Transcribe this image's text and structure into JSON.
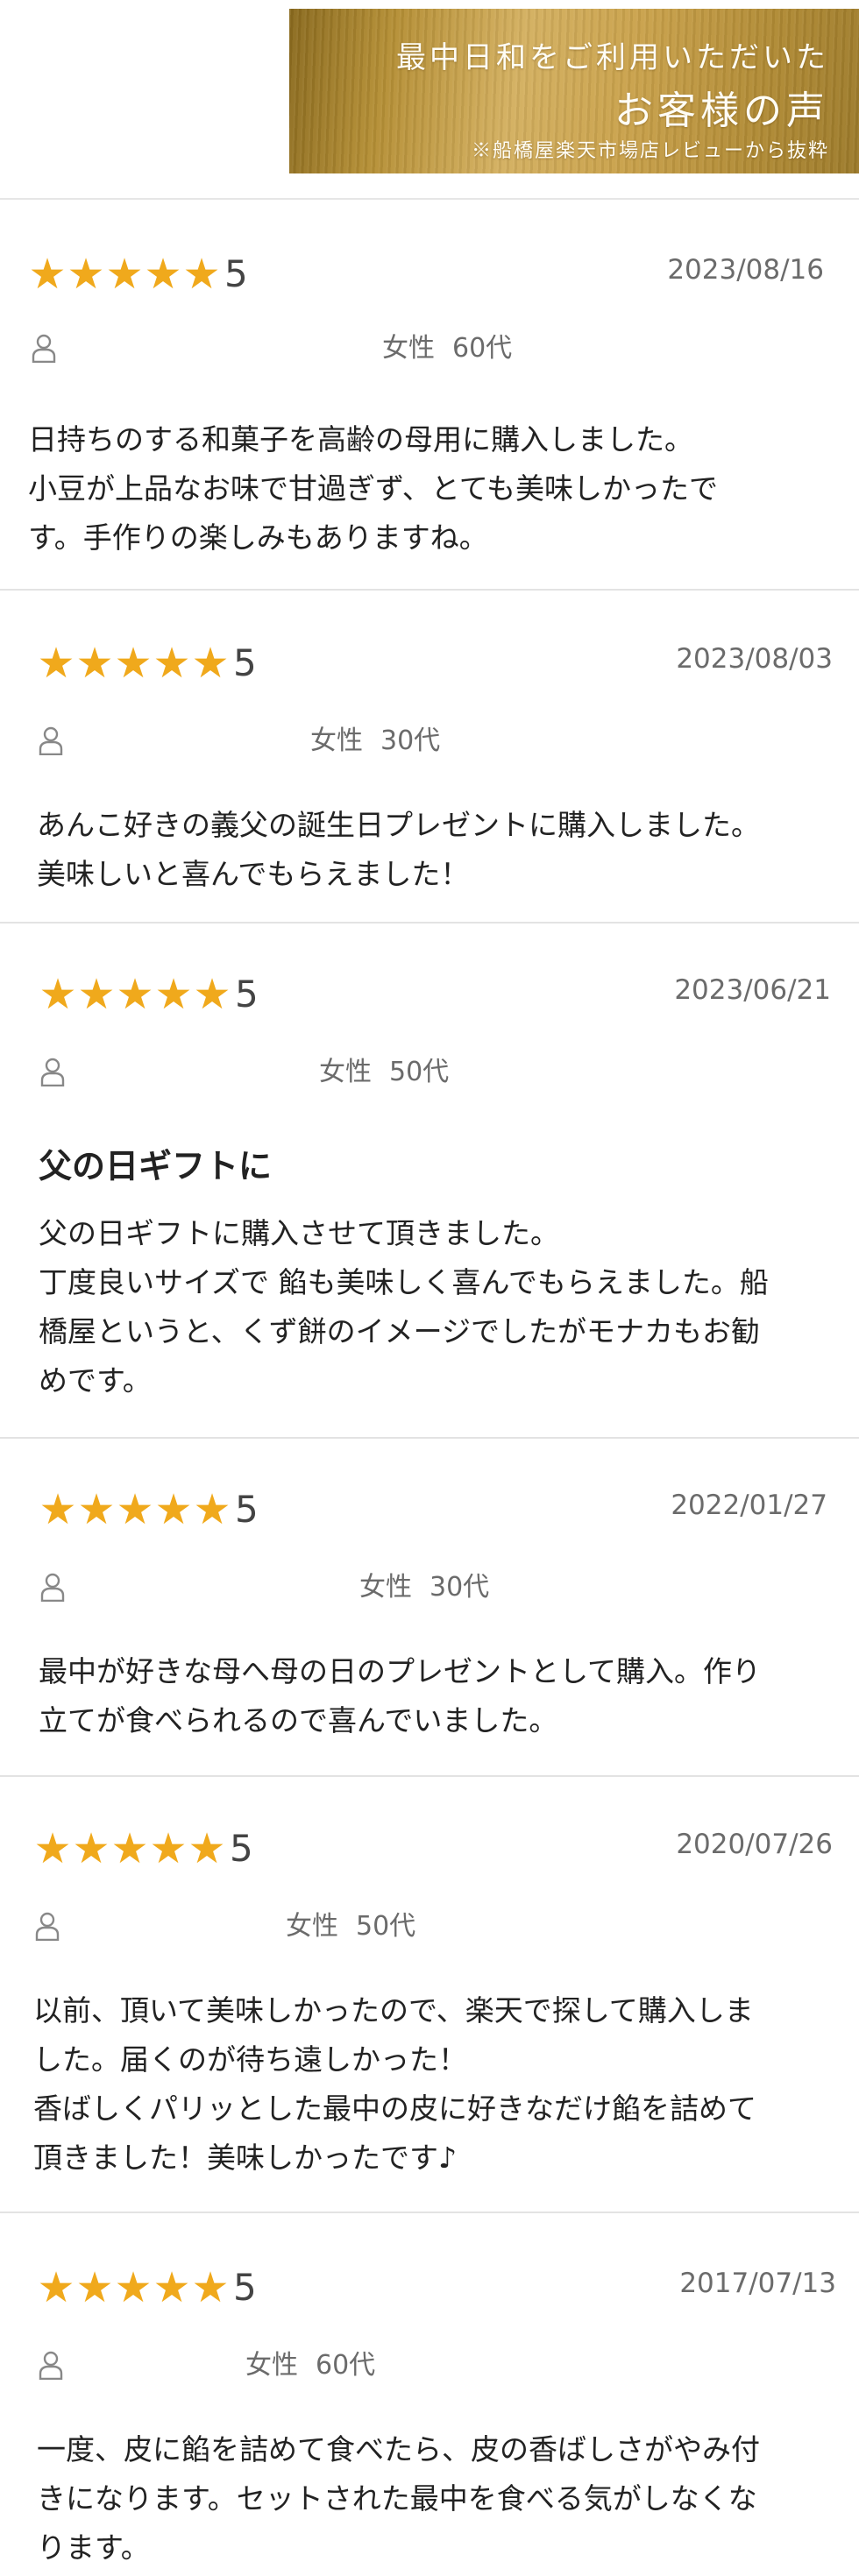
{
  "header": {
    "line1": "最中日和をご利用いただいた",
    "line2": "お客様の声",
    "line3": "※船橋屋楽天市場店レビューから抜粋"
  },
  "colors": {
    "star": "#f0a91c",
    "banner_gold": "#c9a14a"
  },
  "icons": {
    "star": "star-icon",
    "user": "user-icon"
  },
  "reviews": [
    {
      "rating": 5,
      "score": "5",
      "date": "2023/08/16",
      "gender": "女性",
      "age": "60代",
      "title": "",
      "lines": [
        "日持ちのする和菓子を高齢の母用に購入しました。",
        "小豆が上品なお味で甘過ぎず、とても美味しかったで",
        "す。手作りの楽しみもありますね。"
      ]
    },
    {
      "rating": 5,
      "score": "5",
      "date": "2023/08/03",
      "gender": "女性",
      "age": "30代",
      "title": "",
      "lines": [
        "あんこ好きの義父の誕生日プレゼントに購入しました。",
        "美味しいと喜んでもらえました！"
      ]
    },
    {
      "rating": 5,
      "score": "5",
      "date": "2023/06/21",
      "gender": "女性",
      "age": "50代",
      "title": "父の日ギフトに",
      "lines": [
        "父の日ギフトに購入させて頂きました。",
        "丁度良いサイズで 餡も美味しく喜んでもらえました。船",
        "橋屋というと、くず餅のイメージでしたがモナカもお勧",
        "めです。"
      ]
    },
    {
      "rating": 5,
      "score": "5",
      "date": "2022/01/27",
      "gender": "女性",
      "age": "30代",
      "title": "",
      "lines": [
        "最中が好きな母へ母の日のプレゼントとして購入。作り",
        "立てが食べられるので喜んでいました。"
      ]
    },
    {
      "rating": 5,
      "score": "5",
      "date": "2020/07/26",
      "gender": "女性",
      "age": "50代",
      "title": "",
      "lines": [
        "以前、頂いて美味しかったので、楽天で探して購入しま",
        "した。届くのが待ち遠しかった！",
        "香ばしくパリッとした最中の皮に好きなだけ餡を詰めて",
        "頂きました！美味しかったです♪"
      ]
    },
    {
      "rating": 5,
      "score": "5",
      "date": "2017/07/13",
      "gender": "女性",
      "age": "60代",
      "title": "",
      "lines": [
        "一度、皮に餡を詰めて食べたら、皮の香ばしさがやみ付",
        "きになります。セットされた最中を食べる気がしなくな",
        "ります。"
      ]
    }
  ]
}
